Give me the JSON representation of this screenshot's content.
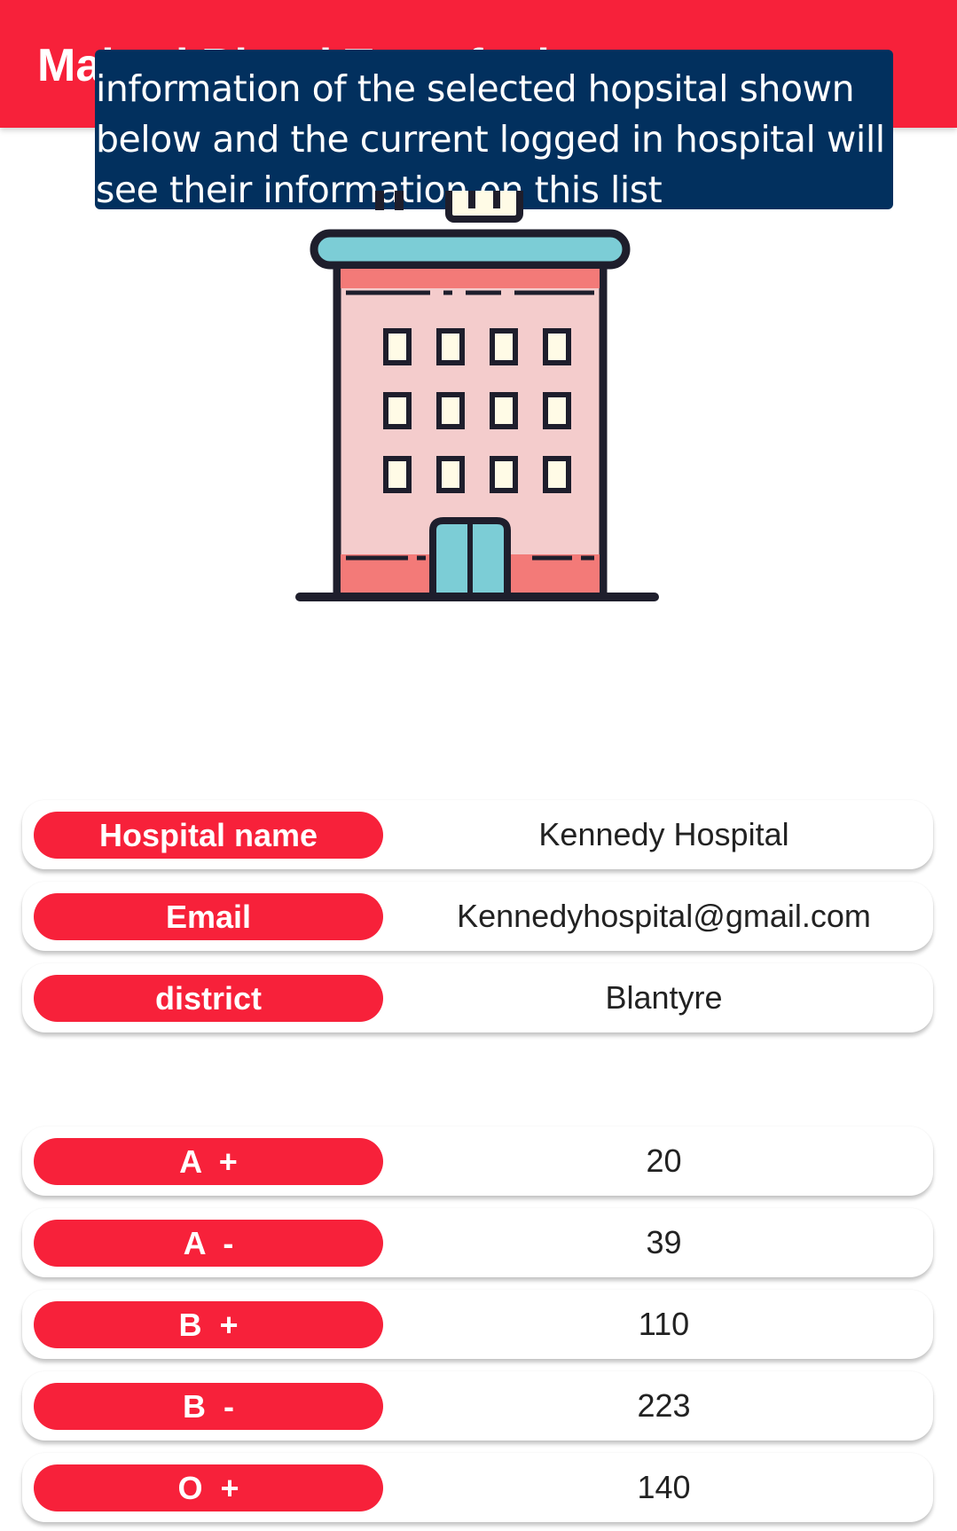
{
  "app_bar": {
    "title": "Malawi Blood Transfusion",
    "color": "#f7213a"
  },
  "tooltip": {
    "text": "information of the selected hopsital shown below and the current logged in hospital will see their information on this list",
    "color": "#02305e"
  },
  "illustration": {
    "icon": "hospital-building-icon"
  },
  "hospital_info": [
    {
      "label": "Hospital name",
      "value": "Kennedy Hospital"
    },
    {
      "label": "Email",
      "value": "Kennedyhospital@gmail.com"
    },
    {
      "label": "district",
      "value": "Blantyre"
    }
  ],
  "blood_stock": [
    {
      "label": "A  +",
      "value": "20"
    },
    {
      "label": "A  -",
      "value": "39"
    },
    {
      "label": "B  +",
      "value": "110"
    },
    {
      "label": "B  -",
      "value": "223"
    },
    {
      "label": "O  +",
      "value": "140"
    }
  ]
}
